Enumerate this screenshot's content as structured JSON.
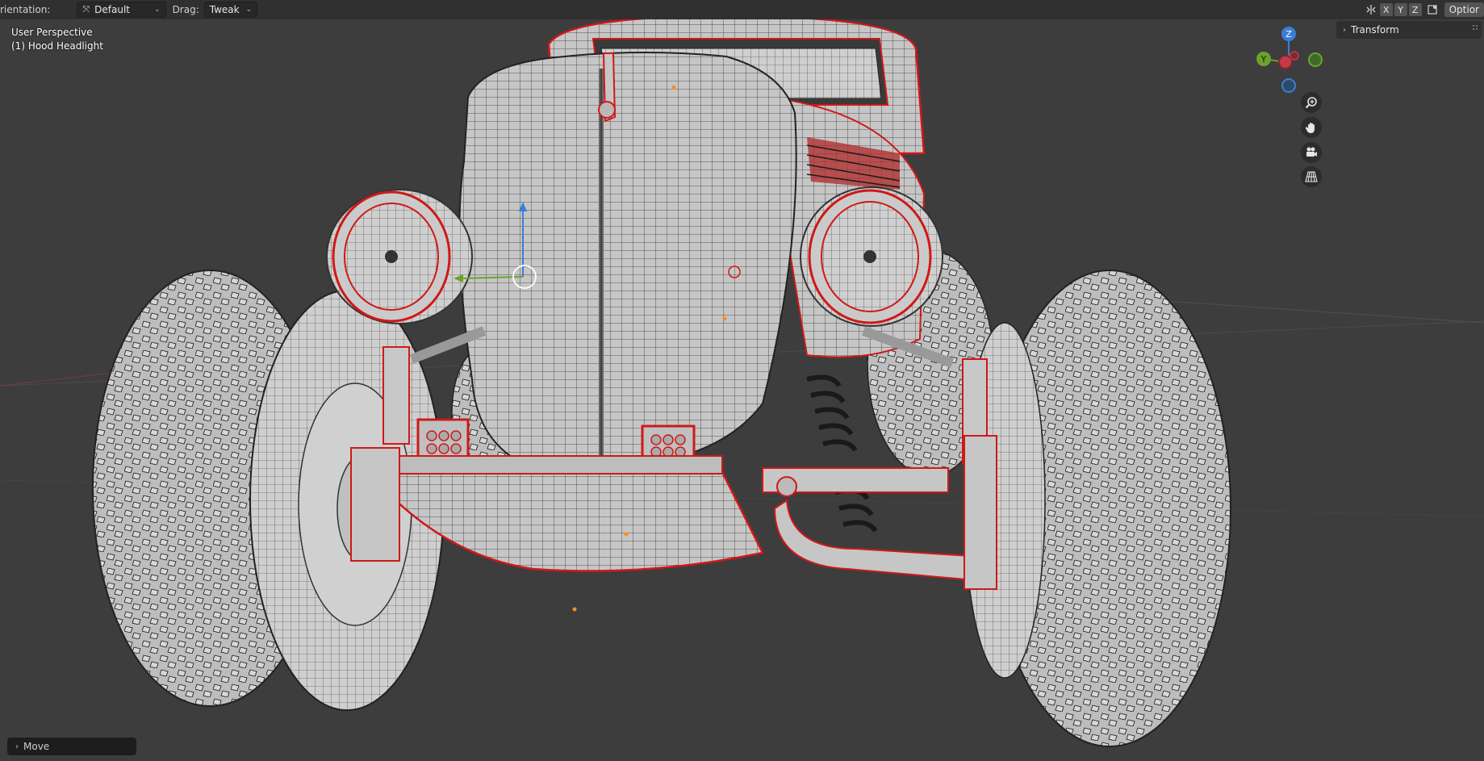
{
  "header": {
    "orientation_label": "rientation:",
    "orientation_value": "Default",
    "drag_label": "Drag:",
    "drag_value": "Tweak",
    "axes": [
      "X",
      "Y",
      "Z"
    ],
    "options_label": "Optior"
  },
  "viewport": {
    "perspective": "User Perspective",
    "selection": "(1) Hood Headlight"
  },
  "sidebar": {
    "transform_label": "Transform"
  },
  "gizmo": {
    "x_label": "",
    "y_label": "Y",
    "z_label": "Z"
  },
  "navigation": {
    "icons": [
      "zoom-icon",
      "hand-pan-icon",
      "camera-icon",
      "grid-perspective-icon"
    ]
  },
  "operator_panel": {
    "label": "Move"
  },
  "colors": {
    "background": "#3d3d3d",
    "header": "#303030",
    "selection_outline": "#d01818",
    "mesh": "#c9c9c9",
    "axis_x": "#c43a4a",
    "axis_y": "#6ba329",
    "axis_z": "#3a7fd6"
  }
}
